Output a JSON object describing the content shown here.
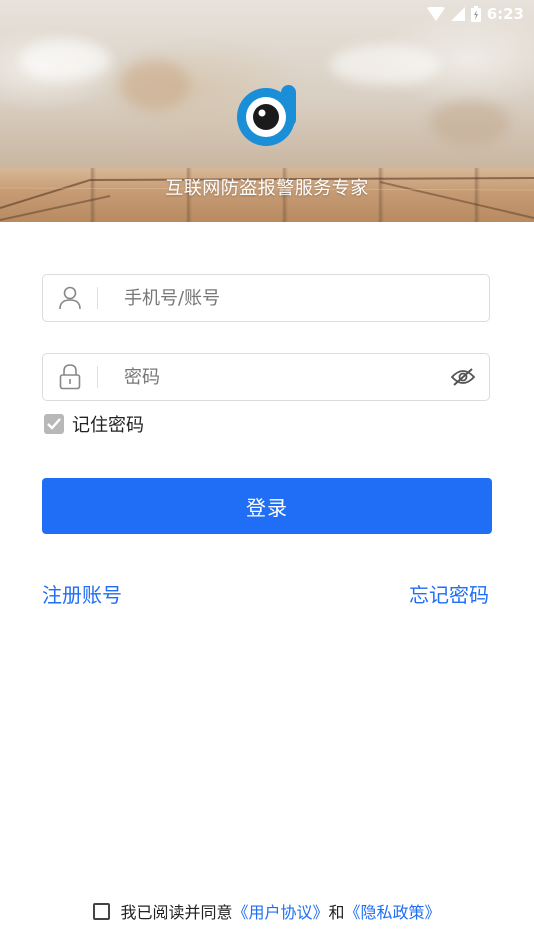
{
  "status_bar": {
    "time": "6:23"
  },
  "hero": {
    "tagline": "互联网防盗报警服务专家"
  },
  "login_form": {
    "username_placeholder": "手机号/账号",
    "password_placeholder": "密码",
    "remember_label": "记住密码",
    "remember_checked": true,
    "submit_label": "登录"
  },
  "links": {
    "register": "注册账号",
    "forgot": "忘记密码"
  },
  "agreement": {
    "prefix": "我已阅读并同意",
    "user_agreement": "《用户协议》",
    "conjunction": "和",
    "privacy_policy": "《隐私政策》",
    "checked": false
  },
  "colors": {
    "accent": "#1f6ef5",
    "logo": "#1a8fd8"
  },
  "icons": [
    "wifi-icon",
    "signal-icon",
    "battery-icon",
    "user-icon",
    "lock-icon",
    "eye-off-icon",
    "checkbox-icon"
  ]
}
